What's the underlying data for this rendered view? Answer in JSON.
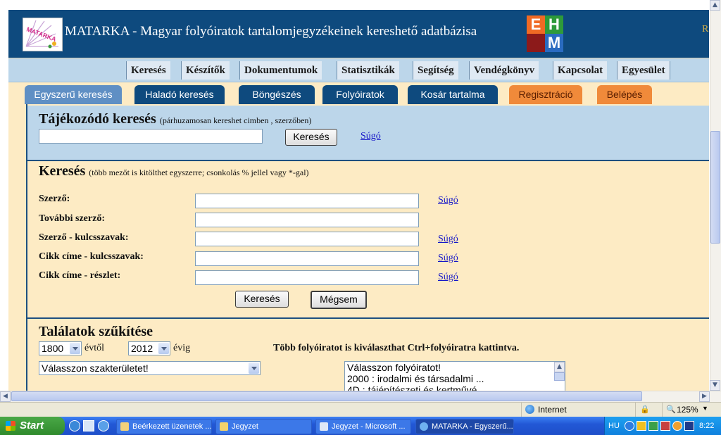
{
  "site": {
    "title": "MATARKA - Magyar folyóiratok tartalomjegyzékeinek kereshető adatbázisa",
    "logo_text": "MATARKA",
    "partner_letters": [
      "E",
      "H",
      "M"
    ],
    "banner_right": "R"
  },
  "menu": [
    "Keresés",
    "Készítők",
    "Dokumentumok",
    "Statisztikák",
    "Segítség",
    "Vendégkönyv",
    "Kapcsolat",
    "Egyesület"
  ],
  "tabs": [
    "Egyszerű keresés",
    "Haladó keresés",
    "Böngészés",
    "Folyóiratok",
    "Kosár tartalma",
    "Regisztráció",
    "Belépés"
  ],
  "quick": {
    "heading": "Tájékozódó keresés",
    "note": "(párhuzamosan kereshet cimben , szerzőben)",
    "button": "Keresés",
    "help": "Súgó"
  },
  "search": {
    "heading": "Keresés",
    "note": "(több mezőt is kitölthet egyszerre; csonkolás % jellel vagy *-gal)",
    "fields": [
      "Szerző:",
      "További szerző:",
      "Szerző - kulcsszavak:",
      "Cikk címe - kulcsszavak:",
      "Cikk címe - részlet:"
    ],
    "help": "Súgó",
    "submit": "Keresés",
    "cancel": "Mégsem"
  },
  "filter": {
    "heading": "Találatok szűkítése",
    "year_from": "1800",
    "year_from_label": "évtől",
    "year_to": "2012",
    "year_to_label": "évig",
    "hint": "Több folyóiratot is kiválaszthat Ctrl+folyóiratra kattintva.",
    "field_select": "Válasszon szakterületet!",
    "journal_options": [
      "Válasszon folyóiratot!",
      "2000 : irodalmi és társadalmi ...",
      "4D : tájépítészeti és kertművé..."
    ]
  },
  "statusbar": {
    "zone": "Internet",
    "zoom": "125%"
  },
  "taskbar": {
    "start": "Start",
    "tasks": [
      "Beérkezett üzenetek ...",
      "Jegyzet",
      "Jegyzet - Microsoft ...",
      "MATARKA - Egyszerű..."
    ],
    "lang": "HU",
    "clock": "8:22"
  },
  "colors": {
    "banner": "#0e4a7e",
    "page_bg": "#fdebc4",
    "box_bg": "#bcd6ea",
    "tab_orange": "#f08a3a"
  }
}
